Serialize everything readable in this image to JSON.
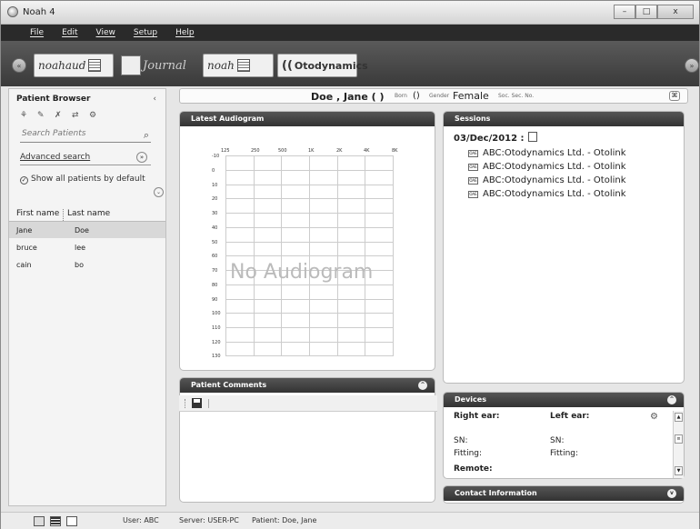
{
  "window": {
    "title": "Noah 4",
    "buttons": {
      "minimize": "–",
      "maximize": "□",
      "close": "x"
    }
  },
  "menu": [
    "File",
    "Edit",
    "View",
    "Setup",
    "Help"
  ],
  "modules": {
    "noahaud": "noahaud",
    "journal": "Journal",
    "noah_ear": "noah",
    "otodynamics": "Otodynamics",
    "nav_left": "«",
    "nav_right": "»"
  },
  "patient_browser": {
    "title": "Patient Browser",
    "collapse": "‹",
    "search_placeholder": "Search Patients",
    "advanced_search": "Advanced search",
    "advanced_icon": "»",
    "show_all": "Show all patients by default",
    "expand_icon": "⌄",
    "columns": [
      "First name",
      "Last name"
    ],
    "patients": [
      {
        "first": "Jane",
        "last": "Doe"
      },
      {
        "first": "bruce",
        "last": "lee"
      },
      {
        "first": "cain",
        "last": "bo"
      }
    ],
    "tool_icons": [
      "add-patient-icon",
      "edit-patient-icon",
      "delete-patient-icon",
      "merge-patient-icon",
      "patient-settings-icon"
    ]
  },
  "banner": {
    "name": "Doe , Jane ( )",
    "born_label": "Born",
    "born_value": "()",
    "gender_label": "Gender",
    "gender_value": "Female",
    "ssn_label": "Soc. Sec. No.",
    "print_icon": "⌘"
  },
  "audiogram": {
    "title": "Latest Audiogram",
    "x_ticks": [
      "125",
      "250",
      "500",
      "1K",
      "2K",
      "4K",
      "8K"
    ],
    "y_ticks": [
      "-10",
      "0",
      "10",
      "20",
      "30",
      "40",
      "50",
      "60",
      "70",
      "80",
      "90",
      "100",
      "110",
      "120",
      "130"
    ],
    "empty_text": "No Audiogram"
  },
  "comments": {
    "title": "Patient Comments",
    "collapse": "^"
  },
  "sessions": {
    "title": "Sessions",
    "date": "03/Dec/2012 :",
    "items": [
      "ABC:Otodynamics Ltd. - Otolink",
      "ABC:Otodynamics Ltd. - Otolink",
      "ABC:Otodynamics Ltd. - Otolink",
      "ABC:Otodynamics Ltd. - Otolink"
    ],
    "item_icon": "OAE"
  },
  "devices": {
    "title": "Devices",
    "right_ear": "Right ear:",
    "left_ear": "Left ear:",
    "sn": "SN:",
    "fitting": "Fitting:",
    "remote": "Remote:",
    "collapse": "^"
  },
  "contact": {
    "title": "Contact Information",
    "expand": "v"
  },
  "status": {
    "user": "User: ABC",
    "server": "Server: USER-PC",
    "patient": "Patient: Doe, Jane"
  }
}
